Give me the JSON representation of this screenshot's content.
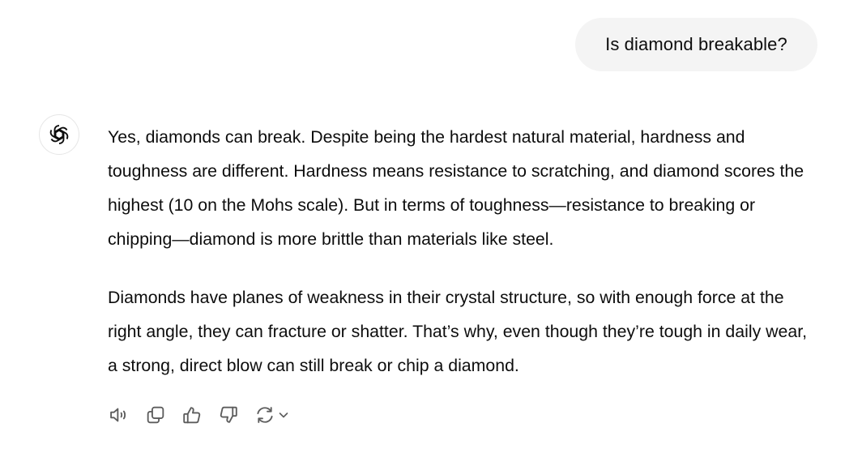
{
  "conversation": {
    "user_message": "Is diamond breakable?",
    "assistant": {
      "avatar_icon": "openai-logo-icon",
      "paragraphs": [
        "Yes, diamonds can break. Despite being the hardest natural material, hardness and toughness are different. Hardness means resistance to scratching, and diamond scores the highest (10 on the Mohs scale). But in terms of toughness—resistance to breaking or chipping—diamond is more brittle than materials like steel.",
        "Diamonds have planes of weakness in their crystal structure, so with enough force at the right angle, they can fracture or shatter. That’s why, even though they’re tough in daily wear, a strong, direct blow can still break or chip a diamond."
      ]
    },
    "actions": [
      {
        "name": "read-aloud-button",
        "icon": "speaker-icon"
      },
      {
        "name": "copy-button",
        "icon": "copy-icon"
      },
      {
        "name": "good-response-button",
        "icon": "thumbs-up-icon"
      },
      {
        "name": "bad-response-button",
        "icon": "thumbs-down-icon"
      },
      {
        "name": "regenerate-button",
        "icon": "refresh-icon"
      }
    ]
  },
  "colors": {
    "bubble_bg": "#f4f4f4",
    "text": "#0d0d0d",
    "icon": "#5d5d5d",
    "avatar_border": "#e6e6e6"
  }
}
